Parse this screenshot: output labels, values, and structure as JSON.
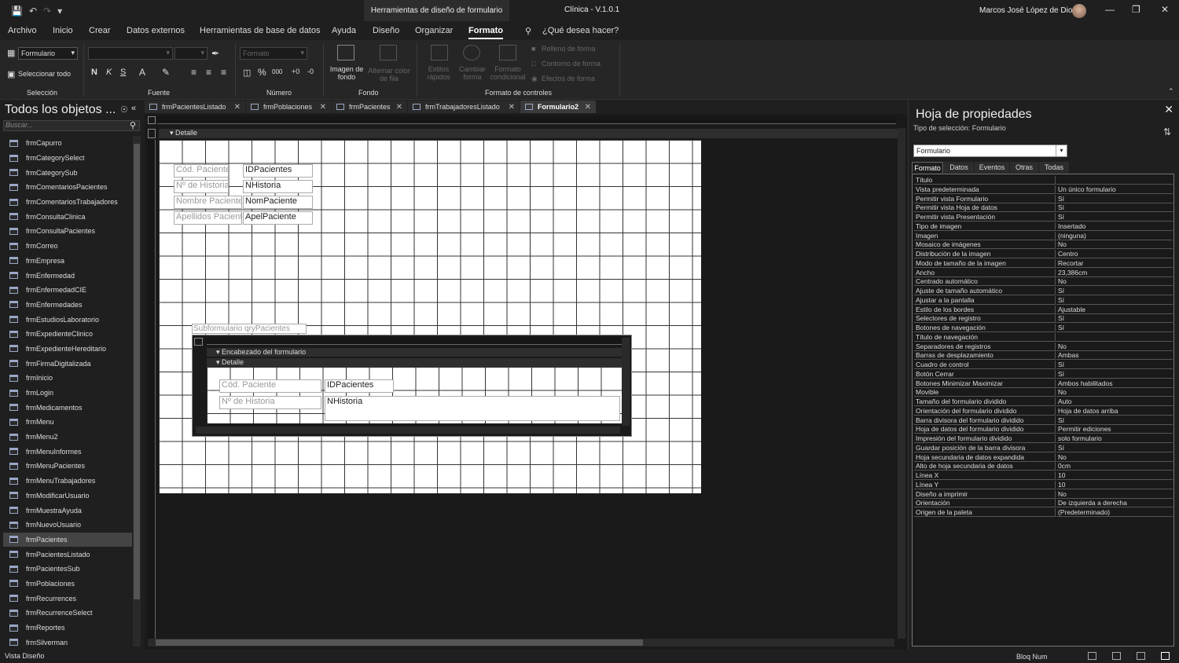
{
  "window": {
    "contextual_tab": "Herramientas de diseño de formulario",
    "title": "Clínica - V.1.0.1",
    "user": "Marcos José López de Dios"
  },
  "menu": [
    "Archivo",
    "Inicio",
    "Crear",
    "Datos externos",
    "Herramientas de base de datos",
    "Ayuda",
    "Diseño",
    "Organizar",
    "Formato",
    "¿Qué desea hacer?"
  ],
  "ribbon": {
    "object_combo": "Formulario",
    "select_all": "Seleccionar todo",
    "format_combo": "Formato",
    "bold": "N",
    "italic": "K",
    "underline": "S",
    "bg_image": "Imagen de fondo",
    "alt_row_color": "Alternar color de fila",
    "quick_styles": "Estilos rápidos",
    "change_shape": "Cambiar forma",
    "cond_format": "Formato condicional",
    "shape_fill": "Relleno de forma",
    "shape_outline": "Contorno de forma",
    "shape_effects": "Efectos de forma",
    "groups": [
      "Selección",
      "Fuente",
      "Número",
      "Fondo",
      "Formato de controles"
    ]
  },
  "nav": {
    "title": "Todos los objetos ...",
    "search_placeholder": "Buscar...",
    "items": [
      "frmCapurro",
      "frmCategorySelect",
      "frmCategorySub",
      "frmComentariosPacientes",
      "frmComentariosTrabajadores",
      "frmConsultaClinica",
      "frmConsultaPacientes",
      "frmCorreo",
      "frmEmpresa",
      "frmEnfermedad",
      "frmEnfermedadCIE",
      "frmEnfermedades",
      "frmEstudiosLaboratorio",
      "frmExpedienteClinico",
      "frmExpedienteHereditario",
      "frmFirmaDigitalizada",
      "frmInicio",
      "frmLogin",
      "frmMedicamentos",
      "frmMenu",
      "frmMenu2",
      "frmMenuInformes",
      "frmMenuPacientes",
      "frmMenuTrabajadores",
      "frmModificarUsuario",
      "frmMuestraAyuda",
      "frmNuevoUsuario",
      "frmPacientes",
      "frmPacientesListado",
      "frmPacientesSub",
      "frmPoblaciones",
      "frmRecurrences",
      "frmRecurrenceSelect",
      "frmReportes",
      "frmSilverman"
    ],
    "selected": "frmPacientes"
  },
  "doc_tabs": [
    "frmPacientesListado",
    "frmPoblaciones",
    "frmPacientes",
    "frmTrabajadoresListado",
    "Formulario2"
  ],
  "design": {
    "section_detail": "Detalle",
    "controls": [
      {
        "label": "Cód. Paciente",
        "field": "IDPacientes"
      },
      {
        "label": "Nº de Historia",
        "field": "NHistoria"
      },
      {
        "label": "Nombre Paciente",
        "field": "NomPaciente"
      },
      {
        "label": "Apellidos Paciente",
        "field": "ApelPaciente"
      }
    ],
    "subform_label": "Subformulario qryPacientes",
    "subform_header": "Encabezado del formulario",
    "subform_detail": "Detalle",
    "subform_controls": [
      {
        "label": "Cód. Paciente",
        "field": "IDPacientes"
      },
      {
        "label": "Nº de Historia",
        "field": "NHistoria"
      }
    ]
  },
  "props": {
    "title": "Hoja de propiedades",
    "selection_type": "Tipo de selección:  Formulario",
    "combo": "Formulario",
    "tabs": [
      "Formato",
      "Datos",
      "Eventos",
      "Otras",
      "Todas"
    ],
    "rows": [
      [
        "Título",
        ""
      ],
      [
        "Vista predeterminada",
        "Un único formulario"
      ],
      [
        "Permitir vista Formulario",
        "Sí"
      ],
      [
        "Permitir vista Hoja de datos",
        "Sí"
      ],
      [
        "Permitir vista Presentación",
        "Sí"
      ],
      [
        "Tipo de imagen",
        "Insertado"
      ],
      [
        "Imagen",
        "(ninguna)"
      ],
      [
        "Mosaico de imágenes",
        "No"
      ],
      [
        "Distribución de la imagen",
        "Centro"
      ],
      [
        "Modo de tamaño de la imagen",
        "Recortar"
      ],
      [
        "Ancho",
        "23,386cm"
      ],
      [
        "Centrado automático",
        "No"
      ],
      [
        "Ajuste de tamaño automático",
        "Sí"
      ],
      [
        "Ajustar a la pantalla",
        "Sí"
      ],
      [
        "Estilo de los bordes",
        "Ajustable"
      ],
      [
        "Selectores de registro",
        "Sí"
      ],
      [
        "Botones de navegación",
        "Sí"
      ],
      [
        "Título de navegación",
        ""
      ],
      [
        "Separadores de registros",
        "No"
      ],
      [
        "Barras de desplazamiento",
        "Ambas"
      ],
      [
        "Cuadro de control",
        "Sí"
      ],
      [
        "Botón Cerrar",
        "Sí"
      ],
      [
        "Botones Minimizar Maximizar",
        "Ambos habilitados"
      ],
      [
        "Movible",
        "No"
      ],
      [
        "Tamaño del formulario dividido",
        "Auto"
      ],
      [
        "Orientación del formulario dividido",
        "Hoja de datos arriba"
      ],
      [
        "Barra divisora del formulario dividido",
        "Sí"
      ],
      [
        "Hoja de datos del formulario dividido",
        "Permitir ediciones"
      ],
      [
        "Impresión del formulario dividido",
        "solo formulario"
      ],
      [
        "Guardar posición de la barra divisora",
        "Sí"
      ],
      [
        "Hoja secundaria de datos expandida",
        "No"
      ],
      [
        "Alto de hoja secundaria de datos",
        "0cm"
      ],
      [
        "Línea X",
        "10"
      ],
      [
        "Línea Y",
        "10"
      ],
      [
        "Diseño a imprimir",
        "No"
      ],
      [
        "Orientación",
        "De izquierda a derecha"
      ],
      [
        "Origen de la paleta",
        "(Predeterminado)"
      ]
    ]
  },
  "status": {
    "left": "Vista Diseño",
    "num_lock": "Bloq Num"
  }
}
